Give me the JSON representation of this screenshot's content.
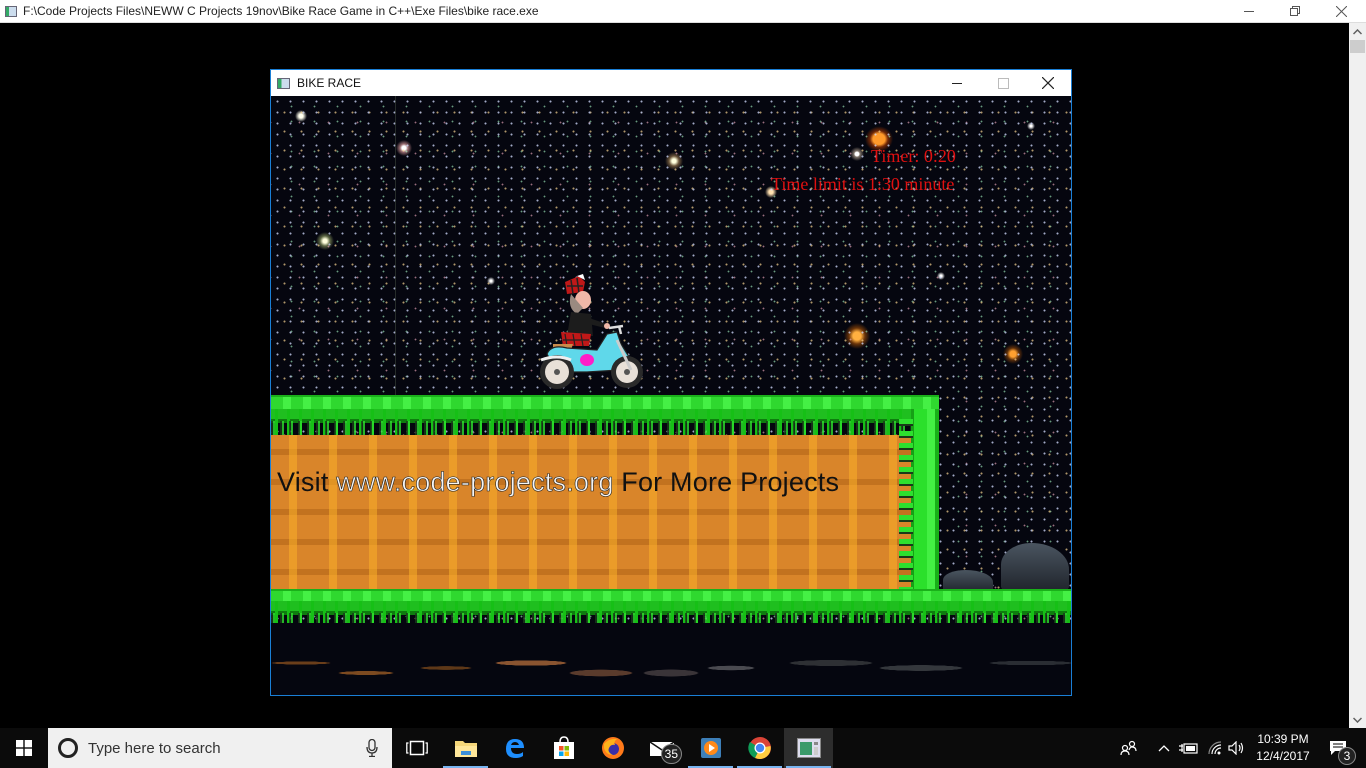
{
  "outer_window": {
    "title": "F:\\Code Projects Files\\NEWW C Projects 19nov\\Bike Race Game in C++\\Exe Files\\bike race.exe",
    "minimize_icon": "minimize-icon",
    "restore_icon": "restore-icon",
    "close_icon": "close-icon"
  },
  "scrollbar": {
    "up_arrow": "▲",
    "down_arrow": "▼",
    "position": 0
  },
  "game_window": {
    "title": "BIKE RACE",
    "minimize_glyph": "—",
    "maximize_glyph": "☐",
    "close_glyph": "✕"
  },
  "hud": {
    "timer": "Timer: 0:20",
    "time_limit": "Time limit is 1:30 minute",
    "text_color": "#e01010"
  },
  "promo": {
    "prefix": "Visit ",
    "url": "www.code-projects.org",
    "suffix": " For More Projects"
  },
  "scene": {
    "background": "starfield-galaxies",
    "player": "motorbike-rider",
    "platforms": [
      "upper-grass-dirt-platform",
      "ground-grass-floor"
    ],
    "grass_color": "#2fd82f",
    "dirt_color": "#d9852a"
  },
  "taskbar": {
    "search_placeholder": "Type here to search",
    "pinned": [
      {
        "name": "task-view",
        "icon": "task-view-icon"
      },
      {
        "name": "file-explorer",
        "icon": "folder-icon"
      },
      {
        "name": "edge",
        "icon": "edge-icon"
      },
      {
        "name": "store",
        "icon": "store-icon"
      },
      {
        "name": "firefox",
        "icon": "firefox-icon"
      },
      {
        "name": "mail",
        "icon": "mail-icon",
        "badge": "35"
      },
      {
        "name": "media-player",
        "icon": "media-player-icon"
      },
      {
        "name": "chrome",
        "icon": "chrome-icon"
      },
      {
        "name": "bike-race",
        "icon": "console-app-icon"
      }
    ],
    "clock_time": "10:39 PM",
    "clock_date": "12/4/2017",
    "notifications_count": "3"
  }
}
